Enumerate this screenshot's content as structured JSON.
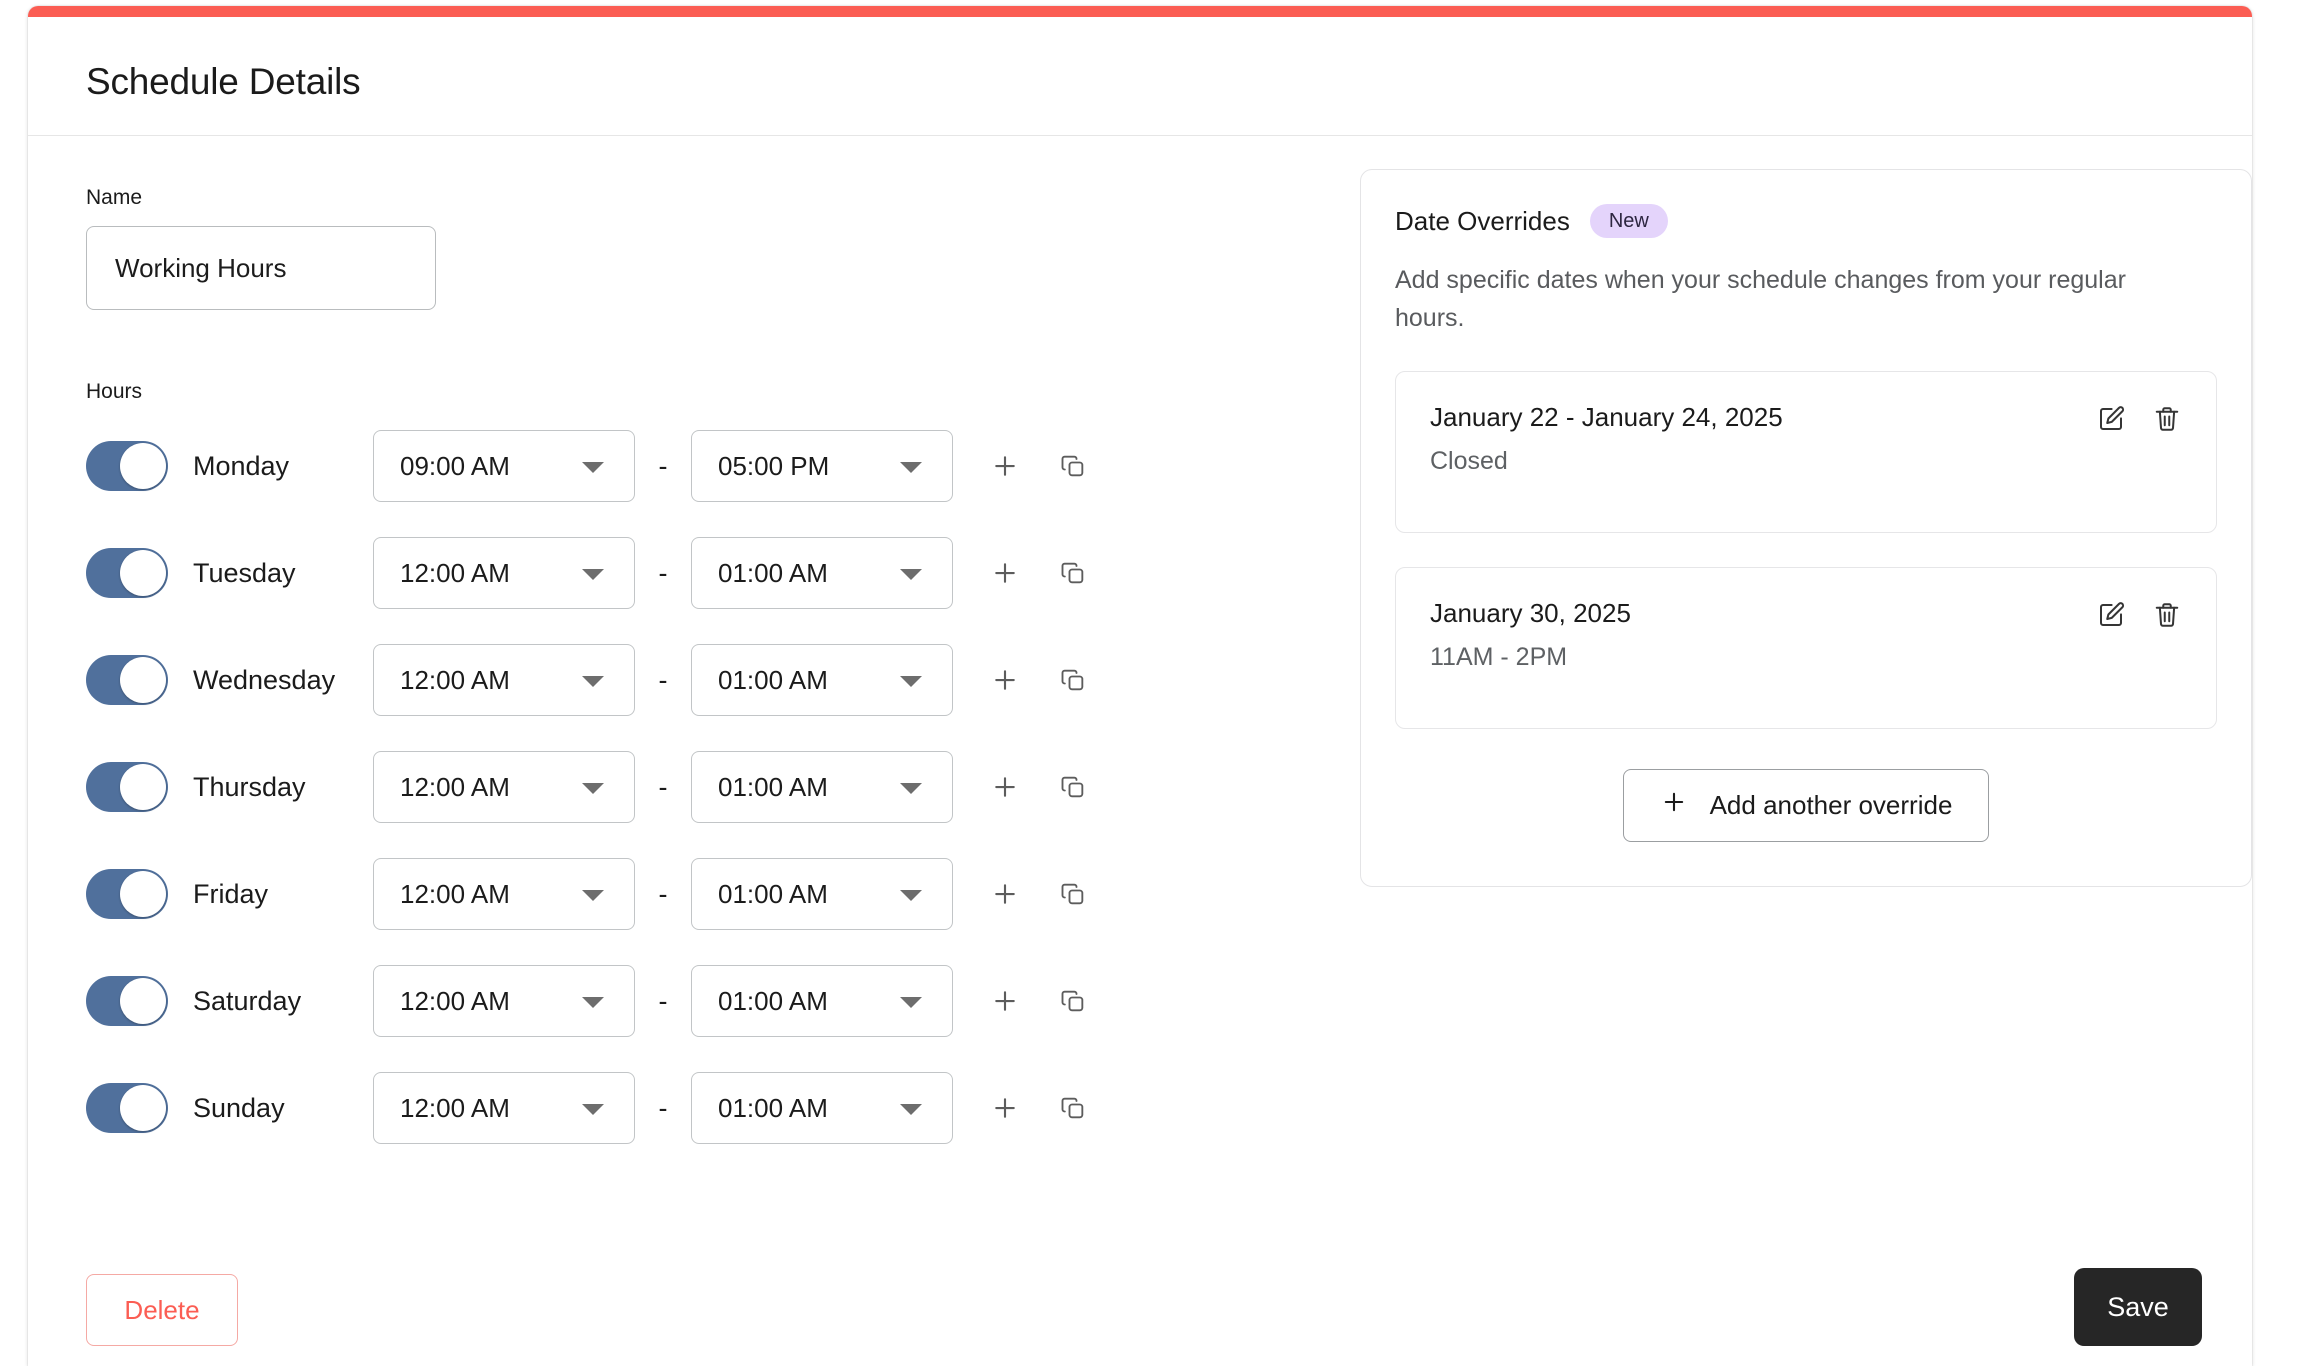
{
  "theme": {
    "accent_bar_color": "#fb5d53",
    "toggle_on_color": "#50709c",
    "badge_bg_color": "#e4d4fb",
    "save_bg_color": "#262626",
    "delete_text_color": "#fb5d53"
  },
  "header": {
    "title": "Schedule Details"
  },
  "form": {
    "name_label": "Name",
    "name_value": "Working Hours",
    "name_placeholder": "Name",
    "hours_label": "Hours",
    "range_separator": "-",
    "add_row_icon": "plus-icon",
    "duplicate_row_icon": "copy-icon",
    "days": [
      {
        "name": "Monday",
        "enabled": true,
        "start": "09:00 AM",
        "end": "05:00 PM"
      },
      {
        "name": "Tuesday",
        "enabled": true,
        "start": "12:00 AM",
        "end": "01:00 AM"
      },
      {
        "name": "Wednesday",
        "enabled": true,
        "start": "12:00 AM",
        "end": "01:00 AM"
      },
      {
        "name": "Thursday",
        "enabled": true,
        "start": "12:00 AM",
        "end": "01:00 AM"
      },
      {
        "name": "Friday",
        "enabled": true,
        "start": "12:00 AM",
        "end": "01:00 AM"
      },
      {
        "name": "Saturday",
        "enabled": true,
        "start": "12:00 AM",
        "end": "01:00 AM"
      },
      {
        "name": "Sunday",
        "enabled": true,
        "start": "12:00 AM",
        "end": "01:00 AM"
      }
    ]
  },
  "overrides": {
    "title": "Date Overrides",
    "badge": "New",
    "description": "Add specific dates when your schedule changes from your regular hours.",
    "items": [
      {
        "date": "January 22 - January 24, 2025",
        "hours": "Closed",
        "edit_icon": "edit-icon",
        "delete_icon": "trash-icon"
      },
      {
        "date": "January 30, 2025",
        "hours": "11AM - 2PM",
        "edit_icon": "edit-icon",
        "delete_icon": "trash-icon"
      }
    ],
    "add_button_label": "Add another override",
    "add_button_icon": "plus-icon"
  },
  "footer": {
    "delete_label": "Delete",
    "save_label": "Save"
  }
}
